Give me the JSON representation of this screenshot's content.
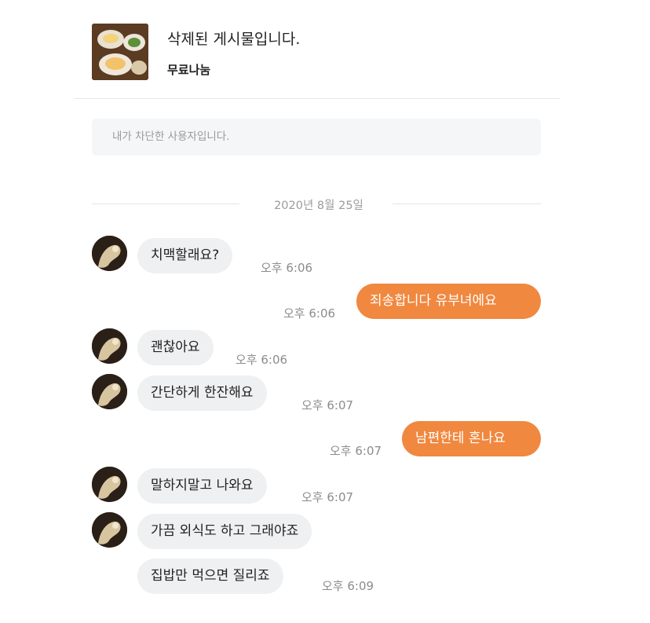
{
  "post": {
    "title": "삭제된 게시물입니다.",
    "subtitle": "무료나눔",
    "thumbnail_icon": "food-dish-photo"
  },
  "blocked_notice": "내가 차단한 사용자입니다.",
  "date_separator": "2020년 8월 25일",
  "colors": {
    "outgoing_bubble": "#f0883f",
    "incoming_bubble": "#eef0f2",
    "notice_bg": "#f5f6f8"
  },
  "messages": [
    {
      "direction": "incoming",
      "text": "치맥할래요?",
      "time": "오후 6:06"
    },
    {
      "direction": "outgoing",
      "text": "죄송합니다 유부녀에요",
      "time": "오후 6:06"
    },
    {
      "direction": "incoming",
      "text": "괜찮아요",
      "time": "오후 6:06"
    },
    {
      "direction": "incoming",
      "text": "간단하게 한잔해요",
      "time": "오후 6:07"
    },
    {
      "direction": "outgoing",
      "text": "남편한테 혼나요",
      "time": "오후 6:07"
    },
    {
      "direction": "incoming",
      "text": "말하지말고 나와요",
      "time": "오후 6:07"
    },
    {
      "direction": "incoming",
      "text": "가끔 외식도 하고 그래야죠",
      "time": ""
    },
    {
      "direction": "incoming",
      "text": "집밥만 먹으면 질리죠",
      "time": "오후 6:09"
    }
  ]
}
